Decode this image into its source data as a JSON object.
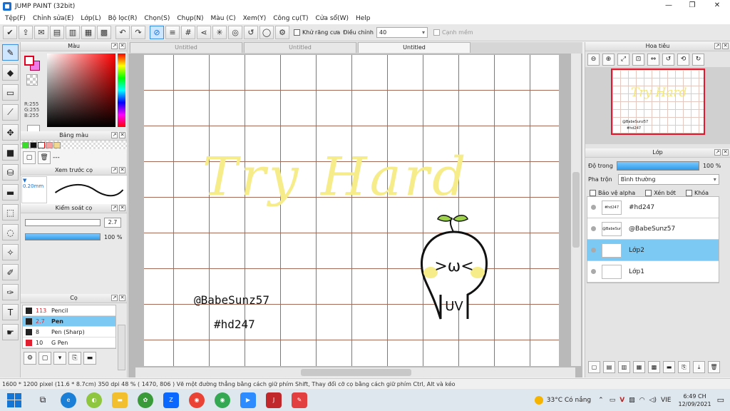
{
  "window": {
    "title": "JUMP PAINT (32bit)"
  },
  "menu": [
    "Tệp(F)",
    "Chỉnh sửa(E)",
    "Lớp(L)",
    "Bộ lọc(R)",
    "Chọn(S)",
    "Chụp(N)",
    "Màu (C)",
    "Xem(Y)",
    "Công cụ(T)",
    "Cửa sổ(W)",
    "Help"
  ],
  "toolbar": {
    "antialias_label": "Khử răng cưa",
    "adjust_label": "Điều chỉnh",
    "adjust_value": "40",
    "edge_label": "Cạnh mềm"
  },
  "color_panel": {
    "title": "Màu",
    "r": "R:255",
    "g": "G:255",
    "b": "B:255",
    "main_color": "#ffffff",
    "sub_color": "#f07ae8"
  },
  "palette": {
    "title": "Bảng màu",
    "dash": "---",
    "swatches": [
      "#3cdc2c",
      "#111111",
      "#ffffff",
      "#f4a0a0",
      "#f0d890"
    ]
  },
  "brush_preview": {
    "title": "Xem trước cọ",
    "size": "▼ 0.20mm"
  },
  "brush_control": {
    "title": "Kiểm soát cọ",
    "size": "2.7",
    "opacity": "100 %",
    "opacity_level": 1.0
  },
  "brushes": {
    "title": "Cọ",
    "items": [
      {
        "size": "113",
        "name": "Pencil",
        "color": "#222222"
      },
      {
        "size": "2.7",
        "name": "Pen",
        "color": "#222222"
      },
      {
        "size": "8",
        "name": "Pen (Sharp)",
        "color": "#222222"
      },
      {
        "size": "10",
        "name": "G Pen",
        "color": "#e02030"
      }
    ]
  },
  "tabs": [
    "Untitled",
    "Untitled",
    "Untitled"
  ],
  "canvas": {
    "title_art": "Try Hard",
    "handle": "@BabeSunz57",
    "tag": "#hd247",
    "face": ">ω<",
    "bottom": "UV"
  },
  "navigator": {
    "title": "Hoa tiêu"
  },
  "layer_panel": {
    "title": "Lớp",
    "opacity_label": "Độ trong",
    "opacity_value": "100 %",
    "blend_label": "Pha trộn",
    "blend_value": "Bình thường",
    "protect_alpha": "Bảo vệ alpha",
    "clip": "Xén bớt",
    "lock": "Khóa"
  },
  "layers": [
    {
      "name": "#hd247",
      "thumb": "#hd247"
    },
    {
      "name": "@BabeSunz57",
      "thumb": "@BabeSunz57"
    },
    {
      "name": "Lớp2",
      "thumb": ""
    },
    {
      "name": "Lớp1",
      "thumb": ""
    }
  ],
  "status": "1600 * 1200 pixel   (11.6 * 8.7cm)   350 dpi   48 %   ( 1470, 806 )   Vẽ một đường thẳng bằng cách giữ phím Shift, Thay đổi cỡ cọ bằng cách giữ phím Ctrl, Alt và kéo",
  "taskbar": {
    "weather": "33°C  Có nắng",
    "lang": "VIE",
    "time": "6:49 CH",
    "date": "12/09/2021"
  }
}
